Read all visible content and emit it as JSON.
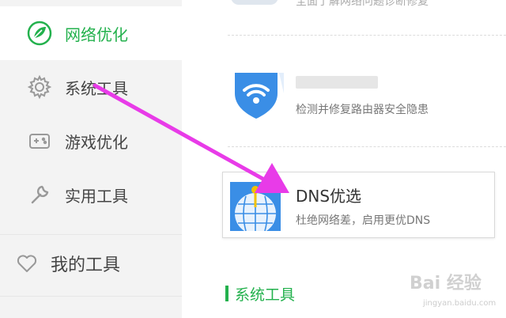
{
  "sidebar": {
    "items": [
      {
        "label": "网络优化",
        "icon": "network-leaf-icon",
        "active": true
      },
      {
        "label": "系统工具",
        "icon": "gear-icon"
      },
      {
        "label": "游戏优化",
        "icon": "gamepad-icon"
      },
      {
        "label": "实用工具",
        "icon": "wrench-icon"
      }
    ],
    "my_tools": {
      "label": "我的工具",
      "icon": "heart-icon"
    }
  },
  "main": {
    "top_item_partial_text": "全面了解网络问题诊断修复",
    "router_item": {
      "desc": "检测并修复路由器安全隐患",
      "icon": "wifi-shield-icon"
    },
    "dns_item": {
      "title": "DNS优选",
      "desc": "杜绝网络差，启用更优DNS",
      "icon": "dns-globe-icon"
    },
    "section_title": "系统工具"
  },
  "watermark": {
    "text": "Bai 经验",
    "sub": "jingyan.baidu.com"
  },
  "colors": {
    "accent": "#23b14d",
    "arrow": "#e83be8",
    "shield_blue": "#3a8ee6"
  }
}
